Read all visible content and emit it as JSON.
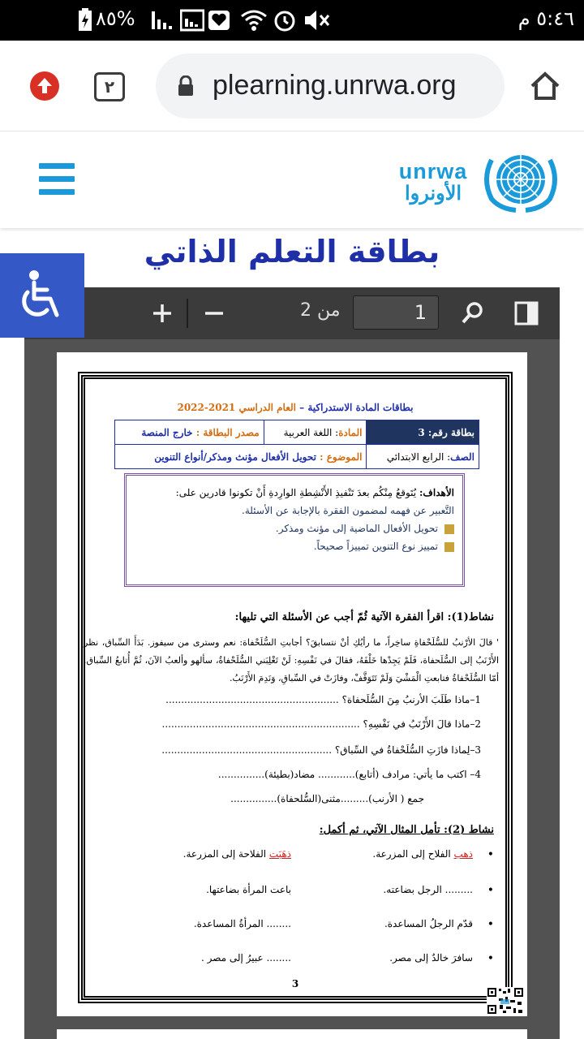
{
  "status_bar": {
    "time": "٥:٤٦ م",
    "battery": "%٨٥"
  },
  "browser": {
    "url": "plearning.unrwa.org",
    "tab_count": "٢"
  },
  "site": {
    "logo_en": "unrwa",
    "logo_ar": "الأونروا",
    "page_title": "بطاقة التعلم الذاتي"
  },
  "pdf_viewer": {
    "current_page": "1",
    "page_count_label": "من 2"
  },
  "document": {
    "header_prefix": "بطاقات المادة الاستدراكية – ",
    "header_year": "العام الدراسي 2021-2022",
    "card_label": "بطاقة رقم: 3",
    "subject_label": "المادة",
    "subject_value": ": اللغة العربية",
    "source_label": "مصدر البطاقة : ",
    "source_value": "خارج المنصة",
    "grade_label": "الصف",
    "grade_value": ": الرابع الابتدائي",
    "topic_label": "الموضوع : ",
    "topic_value": "تحويل الأفعال مؤنث ومذكر/أنواع التنوين",
    "goals_title": "الأهداف:",
    "goals_intro": "يُتَوقعُ مِنْكُم بعدَ تَنْفيذِ الأَنْشِطةِ الوارِدةِ أَنْ تكونوا قادرين على:",
    "goals": [
      "التَّعبير عن فهمه لمضمون الفقرة بالإجابة عن الأسئلة.",
      "تحويل الأفعال الماضية إلى مؤنث ومذكر.",
      "تمييز نوع التنوين تمييزاً صحيحاً."
    ],
    "activity1_title": "نشاط(1): اقرأ الفقرة الآتية ثُمّ أجب عن الأسئلة التي تليها:",
    "paragraph": "' قالَ الأرْنبُ للسُّلَحْفاةِ ساخِراً، ما رأيُكِ أنْ نتسابقَ؟ أجابتِ السُّلَحْفاة: نعم وسترى من سيفوز. بَدَأَ السِّباق، نظر الأَرْنَبُ إلى السُّلَحفاة، فَلَمْ يَجِدْها خَلْفَهُ، فقالَ في نَفْسِهِ: لَنْ تَغْلِبَني السُّلَحْفاةُ، سألهو وألعبُ الآنَ، ثُمَّ أُتابعُ السِّباق. أمّا السُّلَحْفاةُ فتابعتِ الْمَشْيَ وَلَمْ تَتَوَقَّفْ، وفازَتْ في السِّباقِ، وَنَدِمَ الأَرْنَبُ.",
    "questions": [
      "1–ماذا طَلَبَ الأرنبُ مِنَ السُّلَحفاة؟ ........................................................",
      "2–ماذا قالَ الأَرْنَبُ في نَفْسِهِ؟ ................................................................",
      "3–لِماذا فازَتِ السُّلَحْفاةُ في السِّباق؟ .......................................................",
      "4– اكتب ما يأتي: مرادف (أتابع)............ مضاد(بطيئة)...............",
      "جمع ( الأرنب).........مثنى(السُّلحفاة)..............."
    ],
    "activity2_title": "نشاط (2): تأمل المثال الآتي، ثم أكمل:",
    "example": {
      "a_red": "ذهب",
      "a_rest": " الفلاح إلى المزرعة.",
      "b_red": "ذهَبَت",
      "b_rest": " الفلاحة إلى المزرعة."
    },
    "rows": [
      {
        "a": "......... الرجل بضاعته.",
        "b": "باعت المرأة بضاعتها."
      },
      {
        "a": "قدّم الرجلُ المساعدة.",
        "b": "........ المرأةُ المساعدة."
      },
      {
        "a": "سافرَ خالدٌ إلى مصر.",
        "b": "........ عبيرُ إلى مصر ."
      }
    ],
    "page_number": "3"
  },
  "colors": {
    "brand_blue": "#1a9ad9",
    "title_blue": "#1f2fa8",
    "access_blue": "#3459c7",
    "orange": "#d26d10",
    "red": "#d42020"
  }
}
